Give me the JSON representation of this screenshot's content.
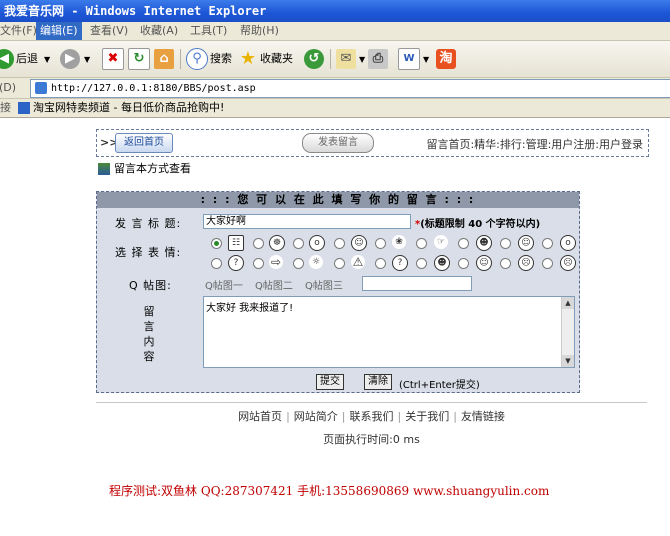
{
  "window": {
    "title": "我爱音乐网 - Windows Internet Explorer"
  },
  "menu": {
    "file": "文件(F)",
    "edit": "编辑(E)",
    "view": "查看(V)",
    "favorites": "收藏(A)",
    "tools": "工具(T)",
    "help": "帮助(H)"
  },
  "toolbar": {
    "back": "后退",
    "search": "搜索",
    "favorites": "收藏夹"
  },
  "address": {
    "label": "址(D)",
    "url": "http://127.0.0.1:8180/BBS/post.asp"
  },
  "links": {
    "label": "接",
    "item": "淘宝网特卖频道 - 每日低价商品抢购中!"
  },
  "nav": {
    "arrows": ">>",
    "home_button": "返回首页",
    "post_button": "发表留言",
    "links_text": "留言首页:精华:排行:管理:用户注册:用户登录"
  },
  "view_mode": "留言本方式查看",
  "form": {
    "header": ": : : 您 可 以 在 此 填 写 你 的 留 言 : : :",
    "title_label": "发 言 标 题:",
    "title_value": "大家好啊",
    "title_note": "(标题限制 40 个字符以内)",
    "emotion_label": "选 择 表 情:",
    "qpic_label": "Q 帖图:",
    "qpic_1": "Q帖图一",
    "qpic_2": "Q帖图二",
    "qpic_3": "Q帖图三",
    "message_label": "留言内容",
    "message_value": "大家好 我来报道了!",
    "submit": "提交",
    "clear": "清除",
    "shortcut_hint": "(Ctrl+Enter提交)"
  },
  "footer": {
    "links": [
      "网站首页",
      "网站简介",
      "联系我们",
      "关于我们",
      "友情链接"
    ],
    "exec_time": "页面执行时间:0 ms",
    "credit": "程序测试:双鱼林 QQ:287307421 手机:13558690869 www.shuangyulin.com"
  },
  "colors": {
    "title_bar": "#1d56d6",
    "form_bg": "#d9dee8",
    "form_header": "#8e98a8",
    "credit": "#c00000"
  }
}
